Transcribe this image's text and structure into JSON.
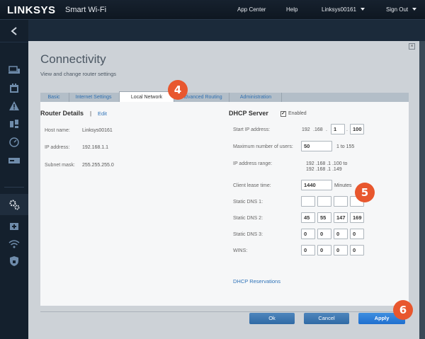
{
  "topbar": {
    "brand": "LINKSYS",
    "product": "Smart Wi-Fi",
    "app_center": "App Center",
    "help": "Help",
    "user": "Linksys00161",
    "sign_out": "Sign Out"
  },
  "modal": {
    "title": "Connectivity",
    "subtitle": "View and change router settings",
    "close_glyph": "×",
    "tabs": {
      "basic": "Basic",
      "internet": "Internet Settings",
      "local": "Local Network",
      "advanced": "Advanced Routing",
      "admin": "Administration"
    }
  },
  "router": {
    "heading": "Router Details",
    "sep": "|",
    "edit": "Edit",
    "host_label": "Host name:",
    "host_value": "Linksys00161",
    "ip_label": "IP address:",
    "ip_value": "192.168.1.1",
    "mask_label": "Subnet mask:",
    "mask_value": "255.255.255.0"
  },
  "dhcp": {
    "heading": "DHCP Server",
    "enabled_label": "Enabled",
    "check_glyph": "✓",
    "start_label": "Start IP address:",
    "start_p1": "192",
    "start_p2": ".168",
    "start_dot": ".",
    "start_p3": "1",
    "start_p4": "100",
    "max_label": "Maximum number of users:",
    "max_value": "50",
    "max_range": "1 to 155",
    "range_label": "IP address range:",
    "range_from": "192 .168 .1 .100  to",
    "range_to": "192 .168 .1 .149",
    "lease_label": "Client lease time:",
    "lease_value": "1440",
    "lease_unit": "Minutes",
    "dns1_label": "Static DNS 1:",
    "dns1": [
      "",
      "",
      "",
      ""
    ],
    "dns2_label": "Static DNS 2:",
    "dns2": [
      "45",
      "55",
      "147",
      "169"
    ],
    "dns3_label": "Static DNS 3:",
    "dns3": [
      "0",
      "0",
      "0",
      "0"
    ],
    "wins_label": "WINS:",
    "wins": [
      "0",
      "0",
      "0",
      "0"
    ],
    "reservations": "DHCP Reservations"
  },
  "buttons": {
    "ok": "Ok",
    "cancel": "Cancel",
    "apply": "Apply"
  },
  "callouts": {
    "c4": "4",
    "c5": "5",
    "c6": "6"
  },
  "colors": {
    "accent": "#2f73b8",
    "callout": "#e8572e"
  }
}
